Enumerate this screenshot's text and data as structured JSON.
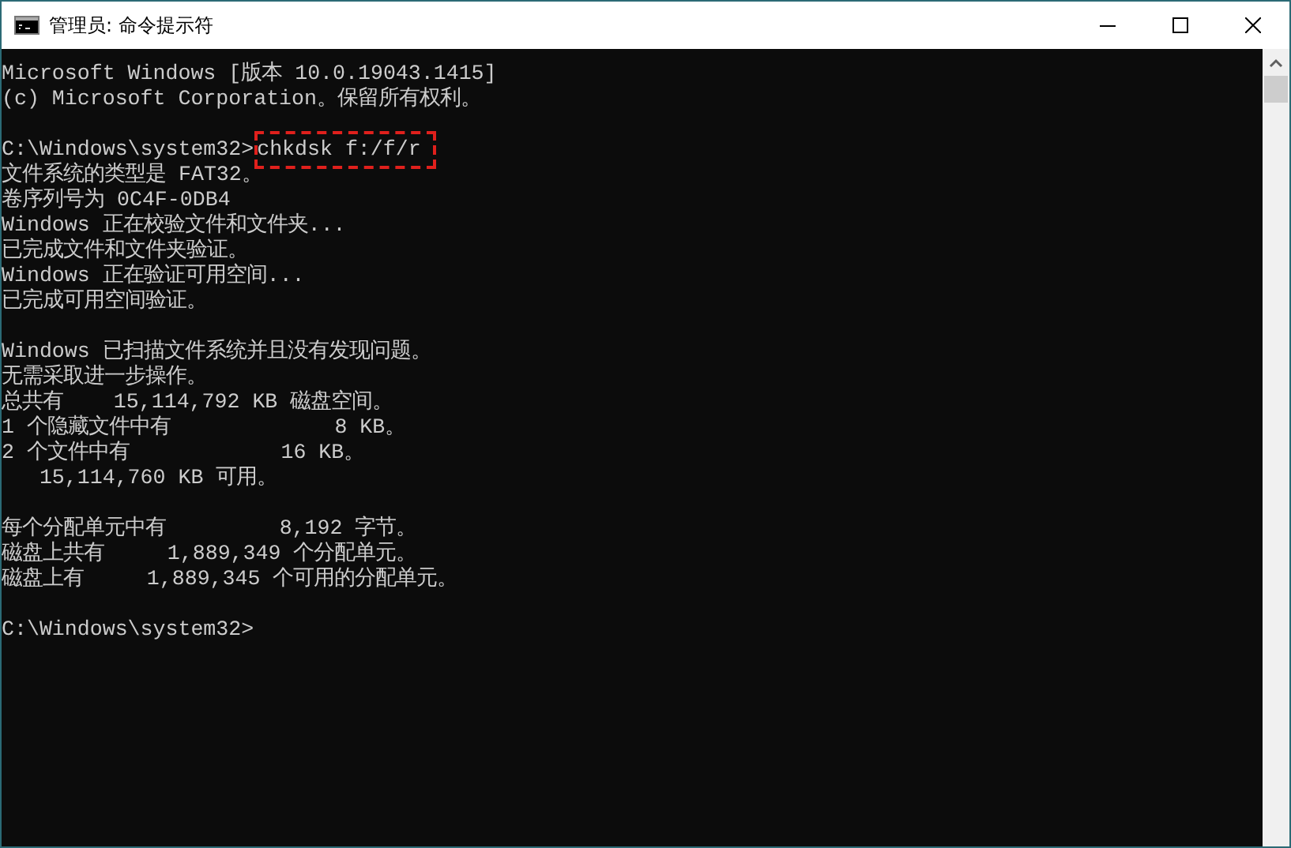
{
  "window": {
    "title": "管理员: 命令提示符"
  },
  "console": {
    "blocks": [
      {
        "lines": [
          {
            "text": "Microsoft Windows [版本 10.0.19043.1415]"
          },
          {
            "text": "(c) Microsoft Corporation。保留所有权利。"
          }
        ]
      },
      {
        "lines": [
          {
            "prompt": "C:\\Windows\\system32>",
            "command": "chkdsk f:/f/r",
            "highlighted": true
          },
          {
            "text": "文件系统的类型是 FAT32。"
          },
          {
            "text": "卷序列号为 0C4F-0DB4"
          },
          {
            "text": "Windows 正在校验文件和文件夹..."
          },
          {
            "text": "已完成文件和文件夹验证。"
          },
          {
            "text": "Windows 正在验证可用空间..."
          },
          {
            "text": "已完成可用空间验证。"
          }
        ]
      },
      {
        "lines": [
          {
            "text": "Windows 已扫描文件系统并且没有发现问题。"
          },
          {
            "text": "无需采取进一步操作。"
          },
          {
            "text": "总共有    15,114,792 KB 磁盘空间。"
          },
          {
            "text": "1 个隐藏文件中有             8 KB。"
          },
          {
            "text": "2 个文件中有            16 KB。"
          },
          {
            "text": "   15,114,760 KB 可用。"
          }
        ]
      },
      {
        "lines": [
          {
            "text": "每个分配单元中有         8,192 字节。"
          },
          {
            "text": "磁盘上共有     1,889,349 个分配单元。"
          },
          {
            "text": "磁盘上有     1,889,345 个可用的分配单元。"
          }
        ]
      },
      {
        "lines": [
          {
            "prompt": "C:\\Windows\\system32>"
          }
        ]
      }
    ]
  }
}
